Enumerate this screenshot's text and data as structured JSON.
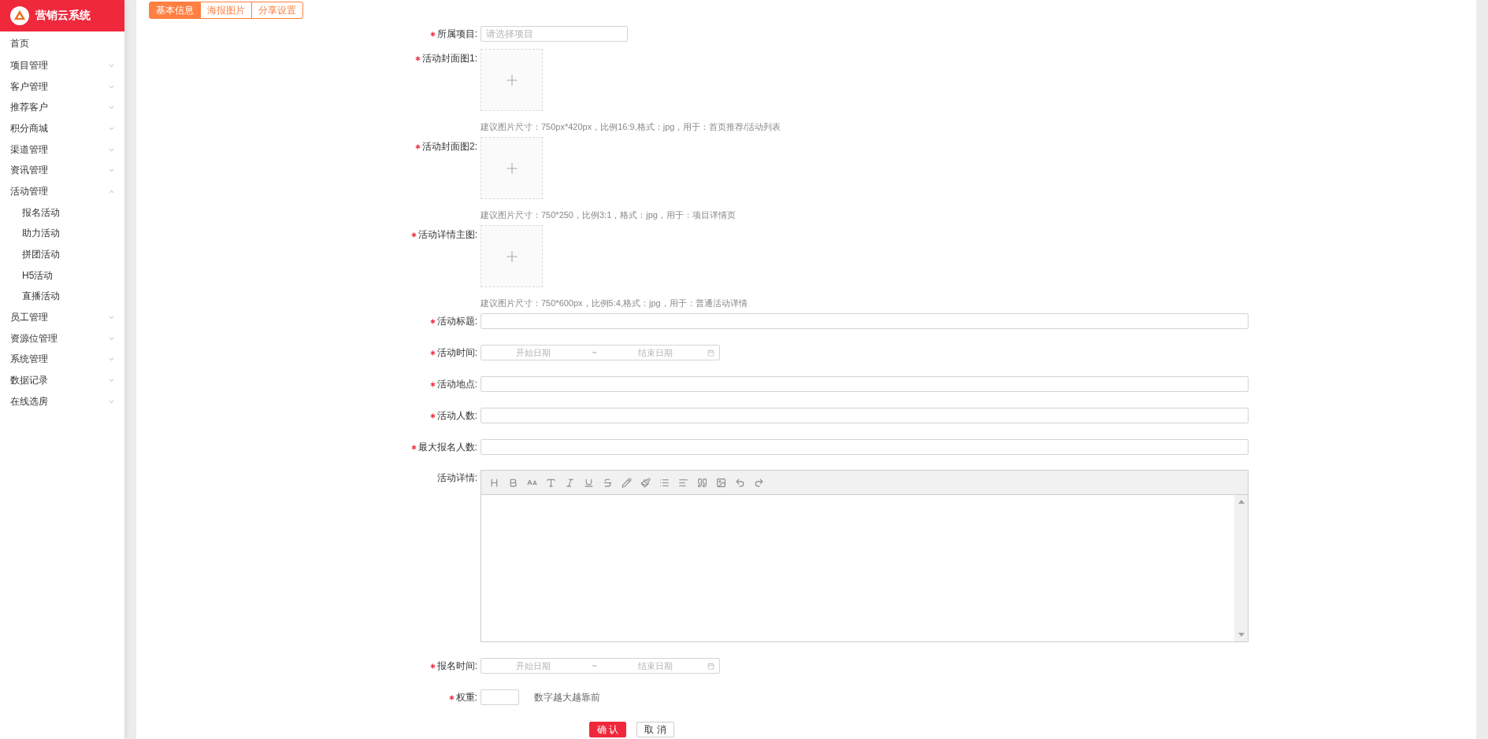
{
  "sidebar": {
    "logo_text": "营销云系统",
    "items": [
      {
        "label": "首页",
        "kind": "link"
      },
      {
        "label": "项目管理",
        "kind": "menu",
        "expanded": false
      },
      {
        "label": "客户管理",
        "kind": "menu",
        "expanded": false
      },
      {
        "label": "推荐客户",
        "kind": "menu",
        "expanded": false
      },
      {
        "label": "积分商城",
        "kind": "menu",
        "expanded": false
      },
      {
        "label": "渠道管理",
        "kind": "menu",
        "expanded": false
      },
      {
        "label": "资讯管理",
        "kind": "menu",
        "expanded": false
      },
      {
        "label": "活动管理",
        "kind": "menu",
        "expanded": true,
        "children": [
          {
            "label": "报名活动"
          },
          {
            "label": "助力活动"
          },
          {
            "label": "拼团活动"
          },
          {
            "label": "H5活动"
          },
          {
            "label": "直播活动"
          }
        ]
      },
      {
        "label": "员工管理",
        "kind": "menu",
        "expanded": false
      },
      {
        "label": "资源位管理",
        "kind": "menu",
        "expanded": false
      },
      {
        "label": "系统管理",
        "kind": "menu",
        "expanded": false
      },
      {
        "label": "数据记录",
        "kind": "menu",
        "expanded": false
      },
      {
        "label": "在线选房",
        "kind": "menu",
        "expanded": false
      }
    ]
  },
  "tabs": [
    {
      "label": "基本信息",
      "selected": true
    },
    {
      "label": "海报图片",
      "selected": false
    },
    {
      "label": "分享设置",
      "selected": false
    }
  ],
  "form": {
    "fields": [
      {
        "kind": "select",
        "label": "所属项目:",
        "required": true,
        "placeholder": "请选择项目"
      },
      {
        "kind": "upload",
        "label": "活动封面图1:",
        "required": true,
        "hint": "建议图片尺寸：750px*420px，比例16:9,格式：jpg，用于：首页推荐/活动列表"
      },
      {
        "kind": "upload",
        "label": "活动封面图2:",
        "required": true,
        "hint": "建议图片尺寸：750*250，比例3:1，格式：jpg，用于：项目详情页"
      },
      {
        "kind": "upload",
        "label": "活动详情主图:",
        "required": true,
        "hint": "建议图片尺寸：750*600px，比例5:4,格式：jpg，用于：普通活动详情"
      },
      {
        "kind": "text",
        "label": "活动标题:",
        "required": true
      },
      {
        "kind": "daterange",
        "label": "活动时间:",
        "required": true,
        "start_placeholder": "开始日期",
        "separator": "~",
        "end_placeholder": "结束日期"
      },
      {
        "kind": "text",
        "label": "活动地点:",
        "required": true
      },
      {
        "kind": "text",
        "label": "活动人数:",
        "required": true
      },
      {
        "kind": "text",
        "label": "最大报名人数:",
        "required": true
      },
      {
        "kind": "editor",
        "label": "活动详情:",
        "required": false
      },
      {
        "kind": "daterange",
        "label": "报名时间:",
        "required": true,
        "start_placeholder": "开始日期",
        "separator": "~",
        "end_placeholder": "结束日期"
      },
      {
        "kind": "number",
        "label": "权重:",
        "required": true,
        "hint": "数字越大越靠前"
      }
    ],
    "buttons": [
      {
        "label": "确 认",
        "kind": "primary"
      },
      {
        "label": "取 消",
        "kind": "default"
      }
    ]
  }
}
